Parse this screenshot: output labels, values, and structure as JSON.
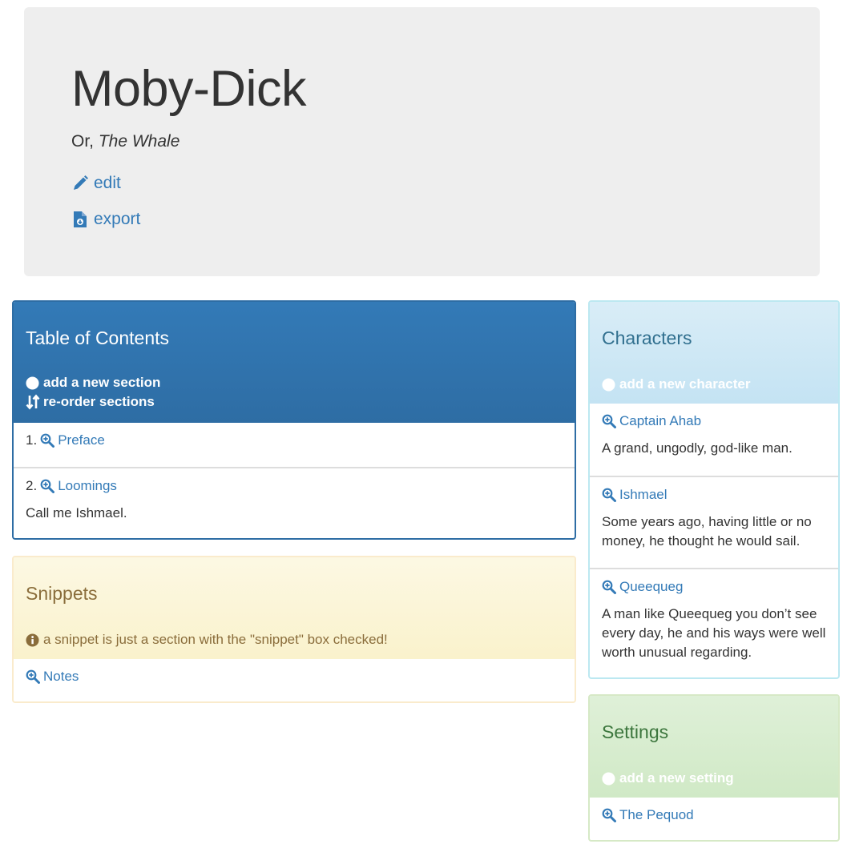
{
  "book": {
    "title": "Moby-Dick",
    "subtitle_prefix": "Or, ",
    "subtitle_em": "The Whale",
    "edit_label": "edit",
    "export_label": "export"
  },
  "toc": {
    "title": "Table of Contents",
    "add_label": "add a new section",
    "reorder_label": "re-order sections",
    "sections": [
      {
        "number": "1.",
        "name": "Preface",
        "text": ""
      },
      {
        "number": "2.",
        "name": "Loomings",
        "text": "Call me Ishmael."
      }
    ]
  },
  "snippets": {
    "title": "Snippets",
    "info": "a snippet is just a section with the \"snippet\" box checked!",
    "items": [
      {
        "name": "Notes"
      }
    ]
  },
  "characters": {
    "title": "Characters",
    "add_label": "add a new character",
    "items": [
      {
        "name": "Captain Ahab",
        "text": "A grand, ungodly, god-like man."
      },
      {
        "name": "Ishmael",
        "text": "Some years ago, having little or no money, he thought he would sail."
      },
      {
        "name": "Queequeg",
        "text": "A man like Queequeg you don’t see every day, he and his ways were well worth unusual regarding."
      }
    ]
  },
  "settings": {
    "title": "Settings",
    "add_label": "add a new setting",
    "items": [
      {
        "name": "The Pequod"
      }
    ]
  },
  "colors": {
    "link": "#337ab7",
    "primary": "#337ab7",
    "warning_text": "#8a6d3b",
    "info_text": "#31708f",
    "success_text": "#3c763d"
  }
}
